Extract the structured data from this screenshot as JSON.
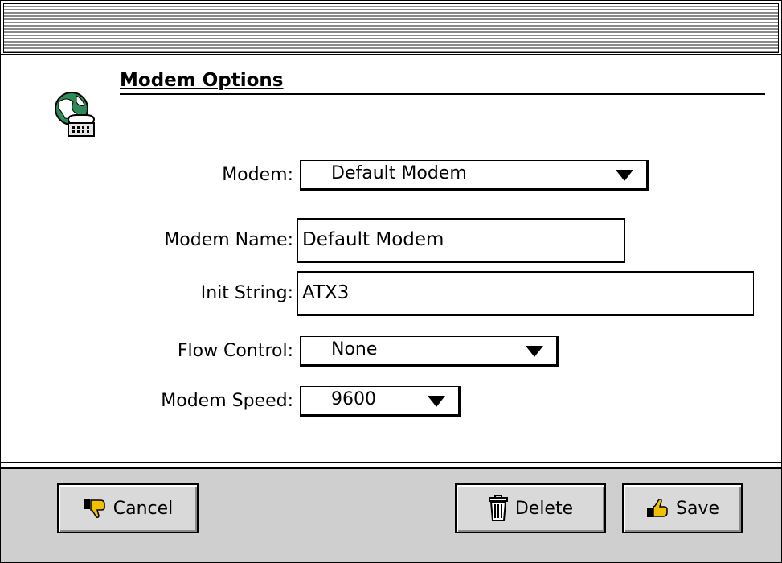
{
  "window": {
    "title": ""
  },
  "dialog": {
    "heading": "Modem Options",
    "icon": "globe-phone-icon"
  },
  "form": {
    "modem": {
      "label": "Modem:",
      "value": "Default Modem"
    },
    "modem_name": {
      "label": "Modem Name:",
      "value": "Default Modem"
    },
    "init_string": {
      "label": "Init String:",
      "value": "ATX3"
    },
    "flow_control": {
      "label": "Flow Control:",
      "value": "None"
    },
    "modem_speed": {
      "label": "Modem Speed:",
      "value": "9600"
    }
  },
  "buttons": {
    "cancel": {
      "label": "Cancel",
      "icon": "thumbs-down-icon"
    },
    "delete": {
      "label": "Delete",
      "icon": "trash-icon"
    },
    "save": {
      "label": "Save",
      "icon": "thumbs-up-icon"
    }
  },
  "colors": {
    "button_bar": "#cfcfcf",
    "button_face": "#d9d9d9",
    "globe_green": "#2e8b57"
  }
}
